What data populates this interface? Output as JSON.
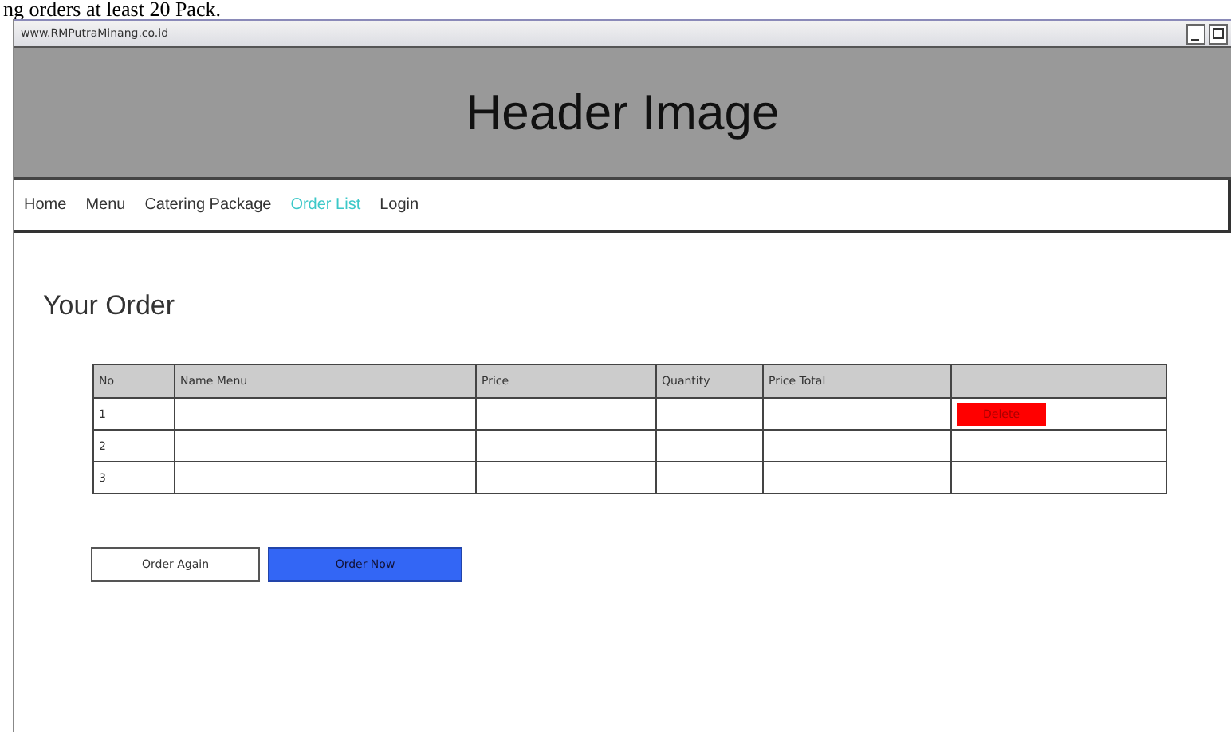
{
  "caption": "ng orders at least 20 Pack.",
  "window": {
    "title": "www.RMPutraMinang.co.id"
  },
  "header": {
    "text": "Header Image"
  },
  "nav": [
    {
      "label": "Home",
      "selected": false
    },
    {
      "label": "Menu",
      "selected": false
    },
    {
      "label": "Catering Package",
      "selected": false
    },
    {
      "label": "Order List",
      "selected": true
    },
    {
      "label": "Login",
      "selected": false
    }
  ],
  "heading": "Your Order",
  "table": {
    "columns": [
      "No",
      "Name Menu",
      "Price",
      "Quantity",
      "Price Total"
    ],
    "rows": [
      {
        "no": "1",
        "action": "Delete"
      },
      {
        "no": "2"
      },
      {
        "no": "3"
      }
    ]
  },
  "buttons": [
    {
      "label": "Order Again",
      "kind": "secondary"
    },
    {
      "label": "Order Now",
      "kind": "primary"
    }
  ]
}
